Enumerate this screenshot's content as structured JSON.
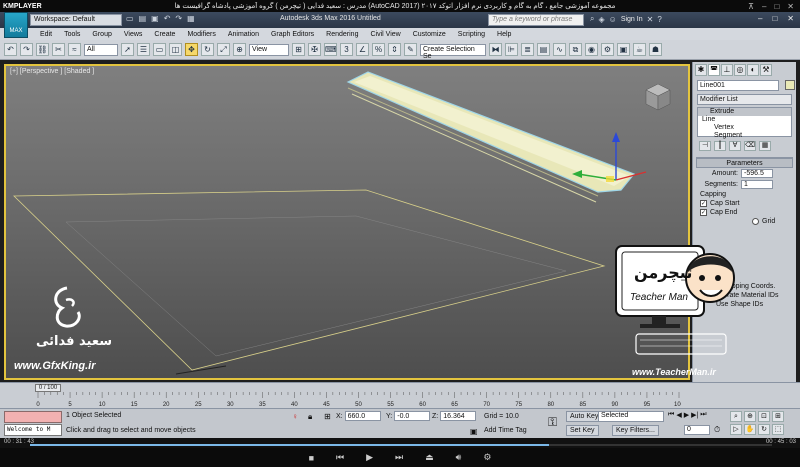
{
  "kmplayer": {
    "logo": "KMPLAYER",
    "title": "مجموعه آموزشی جامع ، گام به گام و کاربردی نرم افزار اتوکد ۲۰۱۷ (AutoCAD 2017) مدرس : سعید فدایی ( تیچرمن ) گروه آموزشی پادشاه گرافیست ها",
    "time_elapsed": "00 : 31 : 43",
    "time_total": "00 : 45 : 03",
    "progress": 0.7
  },
  "titlebar": {
    "workspace": "Workspace: Default",
    "app_title": "Autodesk 3ds Max 2016     Untitled",
    "search_placeholder": "Type a keyword or phrase",
    "signin": "Sign In",
    "max_logo": "MAX"
  },
  "menu": [
    "Edit",
    "Tools",
    "Group",
    "Views",
    "Create",
    "Modifiers",
    "Animation",
    "Graph Editors",
    "Rendering",
    "Civil View",
    "Customize",
    "Scripting",
    "Help"
  ],
  "toolbar": {
    "filter": "All",
    "ref_coord": "View",
    "selection_set": "Create Selection Se"
  },
  "viewport": {
    "label": "[+] [Perspective ] [Shaded ]"
  },
  "command_panel": {
    "object_name": "Line001",
    "modifier_list": "Modifier List",
    "stack": [
      "Extrude",
      "Line",
      "Vertex",
      "Segment"
    ],
    "parameters_title": "Parameters",
    "amount_label": "Amount:",
    "amount_value": "-596.5",
    "segments_label": "Segments:",
    "segments_value": "1",
    "capping_label": "Capping",
    "cap_start": "Cap Start",
    "cap_end": "Cap End",
    "grid": "Grid",
    "mapping_coords": "Mapping Coords.",
    "generate_material_ids": "Generate Material IDs",
    "use_shape_ids": "Use Shape IDs"
  },
  "timeline": {
    "frame_indicator": "0 / 100",
    "ticks": [
      "0",
      "5",
      "10",
      "15",
      "20",
      "25",
      "30",
      "35",
      "40",
      "45",
      "50",
      "55",
      "60",
      "65",
      "70",
      "75",
      "80",
      "85",
      "90",
      "95",
      "100"
    ]
  },
  "status": {
    "maxscript": "Welcome to M",
    "selection": "1 Object Selected",
    "prompt": "Click and drag to select and move objects",
    "x_label": "X:",
    "x_value": "660.0",
    "y_label": "Y:",
    "y_value": "-0.0",
    "z_label": "Z:",
    "z_value": "16.364",
    "grid": "Grid = 10.0",
    "add_time_tag": "Add Time Tag",
    "auto_key": "Auto Key",
    "set_key": "Set Key",
    "selected": "Selected",
    "key_filters": "Key Filters...",
    "frame": "0"
  },
  "watermark": {
    "name": "سعید فدائی",
    "site_left": "www.GfxKing.ir",
    "brand_fa": "تیچرمن",
    "brand_en": "Teacher Man",
    "site_right": "www.TeacherMan.ir"
  }
}
